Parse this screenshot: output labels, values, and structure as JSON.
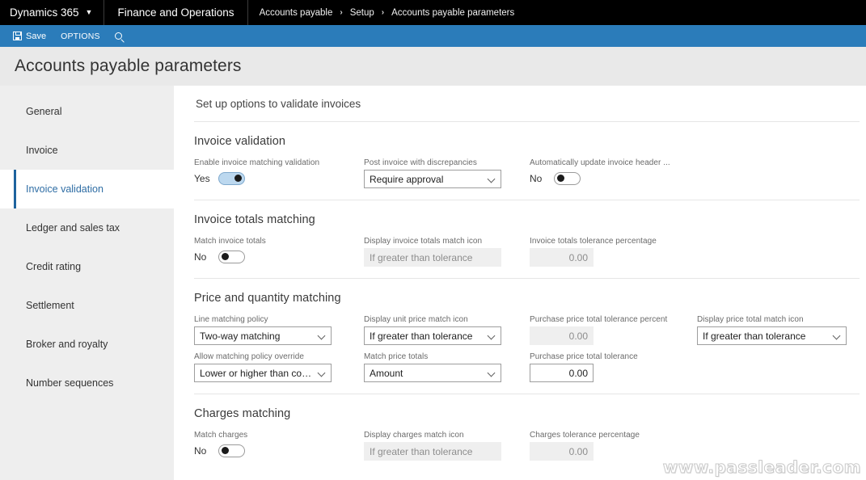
{
  "topbar": {
    "brand": "Dynamics 365",
    "brand_chevron": "chevron-down",
    "module": "Finance and Operations",
    "breadcrumbs": [
      "Accounts payable",
      "Setup",
      "Accounts payable parameters"
    ],
    "separator": "›"
  },
  "commandbar": {
    "save_label": "Save",
    "options_label": "OPTIONS",
    "search_label": ""
  },
  "page": {
    "title": "Accounts payable parameters",
    "content_header": "Set up options to validate invoices"
  },
  "sidebar": {
    "items": [
      {
        "label": "General",
        "active": false
      },
      {
        "label": "Invoice",
        "active": false
      },
      {
        "label": "Invoice validation",
        "active": true
      },
      {
        "label": "Ledger and sales tax",
        "active": false
      },
      {
        "label": "Credit rating",
        "active": false
      },
      {
        "label": "Settlement",
        "active": false
      },
      {
        "label": "Broker and royalty",
        "active": false
      },
      {
        "label": "Number sequences",
        "active": false
      }
    ]
  },
  "sections": {
    "invoice_validation": {
      "title": "Invoice validation",
      "enable_matching": {
        "label": "Enable invoice matching validation",
        "state": "Yes",
        "on": true
      },
      "post_discrepancies": {
        "label": "Post invoice with discrepancies",
        "value": "Require approval"
      },
      "auto_update_header": {
        "label": "Automatically update invoice header ...",
        "state": "No",
        "on": false
      }
    },
    "invoice_totals_matching": {
      "title": "Invoice totals matching",
      "match_invoice_totals": {
        "label": "Match invoice totals",
        "state": "No",
        "on": false
      },
      "display_icon": {
        "label": "Display invoice totals match icon",
        "value": "If greater than tolerance"
      },
      "tolerance_percentage": {
        "label": "Invoice totals tolerance percentage",
        "value": "0.00"
      }
    },
    "price_quantity_matching": {
      "title": "Price and quantity matching",
      "line_matching_policy": {
        "label": "Line matching policy",
        "value": "Two-way matching"
      },
      "display_unit_price_icon": {
        "label": "Display unit price match icon",
        "value": "If greater than tolerance"
      },
      "purchase_price_total_tolerance_percent": {
        "label": "Purchase price total tolerance percent",
        "value": "0.00"
      },
      "display_price_total_icon": {
        "label": "Display price total match icon",
        "value": "If greater than tolerance"
      },
      "allow_policy_override": {
        "label": "Allow matching policy override",
        "value": "Lower or higher than compa..."
      },
      "match_price_totals": {
        "label": "Match price totals",
        "value": "Amount"
      },
      "purchase_price_total_tolerance": {
        "label": "Purchase price total tolerance",
        "value": "0.00"
      }
    },
    "charges_matching": {
      "title": "Charges matching",
      "match_charges": {
        "label": "Match charges",
        "state": "No",
        "on": false
      },
      "display_charges_icon": {
        "label": "Display charges match icon",
        "value": "If greater than tolerance"
      },
      "charges_tolerance_percentage": {
        "label": "Charges tolerance percentage",
        "value": "0.00"
      }
    }
  },
  "watermark": {
    "text": "www.passleader.com"
  },
  "colors": {
    "topbar_bg": "#000000",
    "command_bar_bg": "#2b7cba",
    "title_bg": "#e9e9e9",
    "sidebar_bg": "#eeeeee",
    "active_accent": "#1e639e",
    "toggle_on_bg": "#bcd8ef",
    "disabled_field_bg": "#efefef"
  }
}
